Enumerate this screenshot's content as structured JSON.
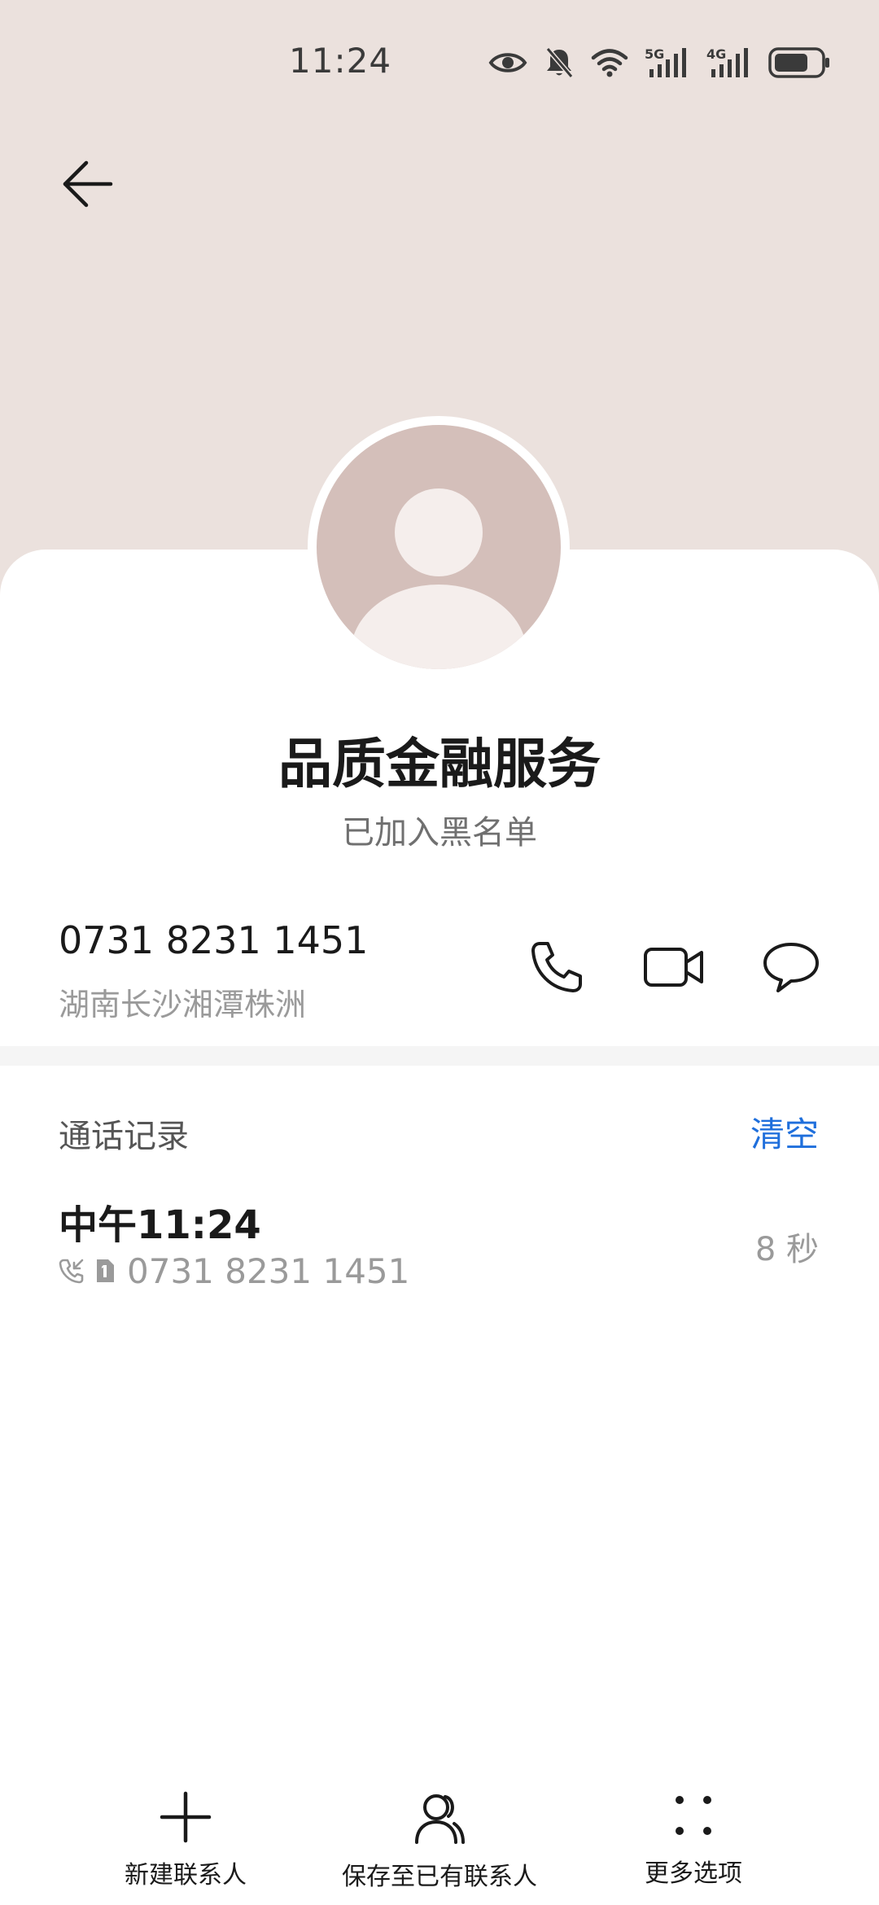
{
  "status_bar": {
    "time": "11:24",
    "network_1": "5G",
    "network_2": "4G"
  },
  "contact": {
    "name": "品质金融服务",
    "status": "已加入黑名单",
    "phone": "0731 8231 1451",
    "location": "湖南长沙湘潭株洲"
  },
  "call_log": {
    "title": "通话记录",
    "clear_label": "清空",
    "records": [
      {
        "time": "中午11:24",
        "number": "0731 8231 1451",
        "duration": "8 秒"
      }
    ]
  },
  "bottom_bar": {
    "new_contact": "新建联系人",
    "save_existing": "保存至已有联系人",
    "more_options": "更多选项"
  },
  "colors": {
    "header_bg": "#ebe1dd",
    "avatar_bg": "#d4bfba",
    "accent": "#1f6fdc"
  },
  "icons": [
    "back-arrow-icon",
    "eye-icon",
    "bell-muted-icon",
    "wifi-icon",
    "signal-icon",
    "battery-icon",
    "phone-icon",
    "video-icon",
    "message-icon",
    "incoming-call-icon",
    "sim-1-icon",
    "plus-icon",
    "person-icon",
    "more-dots-icon"
  ]
}
